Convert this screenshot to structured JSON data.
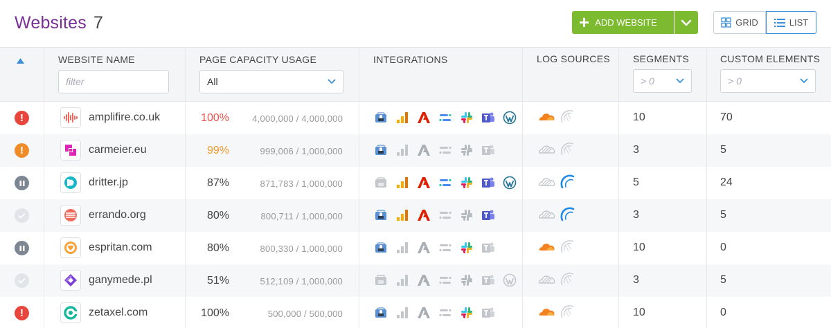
{
  "header": {
    "title": "Websites",
    "count": "7",
    "add_button_label": "ADD WEBSITE",
    "view_grid_label": "GRID",
    "view_list_label": "LIST"
  },
  "columns": {
    "name": "WEBSITE NAME",
    "capacity": "PAGE CAPACITY USAGE",
    "integrations": "INTEGRATIONS",
    "logs": "LOG SOURCES",
    "segments": "SEGMENTS",
    "custom": "CUSTOM ELEMENTS"
  },
  "filters": {
    "name_placeholder": "filter",
    "capacity_value": "All",
    "segments_placeholder": "> 0",
    "custom_placeholder": "> 0"
  },
  "colors": {
    "brand": "#7a2f96",
    "accent_green": "#7cbb2f",
    "accent_blue": "#3b8fd8",
    "status_error": "#e8453c",
    "status_warning": "#f08c28",
    "status_paused": "#7d8794",
    "status_ok": "#e1e4e8"
  },
  "integration_icons": [
    "tag-manager-icon",
    "analytics-icon",
    "adobe-icon",
    "segment-icon",
    "slack-icon",
    "teams-icon",
    "wordpress-icon"
  ],
  "log_icons": [
    "cloudflare-icon",
    "fastly-icon"
  ],
  "rows": [
    {
      "status": "error",
      "favicon": "sound-wave",
      "name": "amplifire.co.uk",
      "pct": "100%",
      "pct_color": "#ef5350",
      "capacity": "4,000,000 / 4,000,000",
      "integrations": [
        1,
        1,
        1,
        1,
        1,
        1,
        1
      ],
      "logs": [
        1,
        0
      ],
      "segments": "10",
      "custom": "70"
    },
    {
      "status": "warning",
      "favicon": "square-logo",
      "name": "carmeier.eu",
      "pct": "99%",
      "pct_color": "#f59a2c",
      "capacity": "999,006 / 1,000,000",
      "integrations": [
        1,
        0,
        0,
        0,
        0,
        0,
        -1
      ],
      "logs": [
        0,
        0
      ],
      "segments": "3",
      "custom": "5"
    },
    {
      "status": "paused",
      "favicon": "d-logo",
      "name": "dritter.jp",
      "pct": "87%",
      "pct_color": "#444444",
      "capacity": "871,783 / 1,000,000",
      "integrations": [
        0,
        1,
        1,
        1,
        1,
        1,
        1
      ],
      "logs": [
        0,
        1
      ],
      "segments": "5",
      "custom": "24"
    },
    {
      "status": "ok",
      "favicon": "stripes-logo",
      "name": "errando.org",
      "pct": "80%",
      "pct_color": "#444444",
      "capacity": "800,711 / 1,000,000",
      "integrations": [
        1,
        1,
        1,
        0,
        0,
        1,
        -1
      ],
      "logs": [
        0,
        1
      ],
      "segments": "3",
      "custom": "5"
    },
    {
      "status": "paused",
      "favicon": "heart-logo",
      "name": "espritan.com",
      "pct": "80%",
      "pct_color": "#444444",
      "capacity": "800,330 / 1,000,000",
      "integrations": [
        1,
        0,
        0,
        0,
        1,
        0,
        -1
      ],
      "logs": [
        1,
        0
      ],
      "segments": "10",
      "custom": "0"
    },
    {
      "status": "ok",
      "favicon": "diamond-logo",
      "name": "ganymede.pl",
      "pct": "51%",
      "pct_color": "#444444",
      "capacity": "512,109 / 1,000,000",
      "integrations": [
        0,
        0,
        0,
        0,
        0,
        0,
        0
      ],
      "logs": [
        0,
        0
      ],
      "segments": "3",
      "custom": "5"
    },
    {
      "status": "error",
      "favicon": "c-logo",
      "name": "zetaxel.com",
      "pct": "100%",
      "pct_color": "#444444",
      "capacity": "500,000 / 500,000",
      "integrations": [
        1,
        0,
        0,
        0,
        1,
        0,
        -1
      ],
      "logs": [
        1,
        0
      ],
      "segments": "10",
      "custom": "0"
    }
  ]
}
